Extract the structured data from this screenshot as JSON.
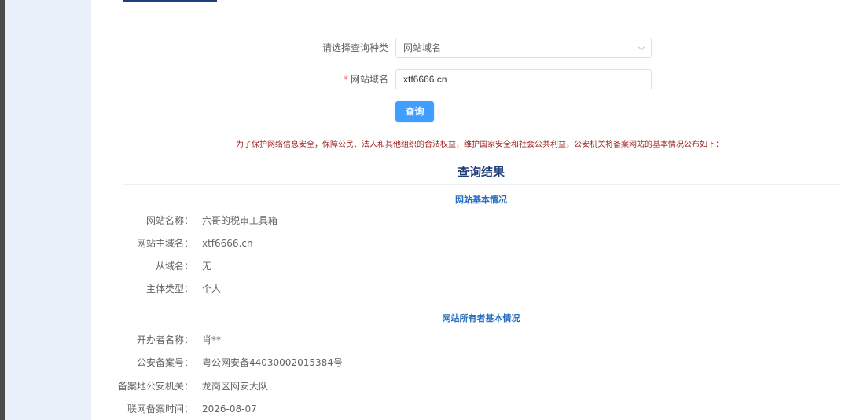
{
  "form": {
    "query_type_label": "请选择查询种类",
    "query_type_value": "网站域名",
    "required_mark": "*",
    "domain_label": "网站域名",
    "domain_value": "xtf6666.cn",
    "query_button": "查询"
  },
  "notice": "为了保护网络信息安全，保障公民、法人和其他组织的合法权益，维护国家安全和社会公共利益，公安机关将备案网站的基本情况公布如下：",
  "result": {
    "title": "查询结果",
    "site_section": {
      "title": "网站基本情况",
      "rows": [
        {
          "label": "网站名称：",
          "value": "六哥的税审工具箱"
        },
        {
          "label": "网站主域名：",
          "value": "xtf6666.cn"
        },
        {
          "label": "从域名：",
          "value": "无"
        },
        {
          "label": "主体类型：",
          "value": "个人"
        }
      ]
    },
    "owner_section": {
      "title": "网站所有者基本情况",
      "rows": [
        {
          "label": "开办者名称：",
          "value": "肖**"
        },
        {
          "label": "公安备案号：",
          "value": "粤公网安备44030002015384号"
        },
        {
          "label": "备案地公安机关：",
          "value": "龙岗区网安大队"
        },
        {
          "label": "联网备案时间：",
          "value": "2026-08-07"
        }
      ]
    }
  }
}
